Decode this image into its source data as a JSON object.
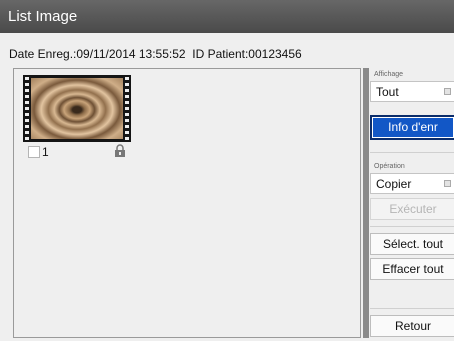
{
  "window": {
    "title": "List Image"
  },
  "patient_info": {
    "date_label": "Date Enreg.:09/11/2014 13:55:52",
    "id_label": "ID Patient:00123456"
  },
  "thumbnails": [
    {
      "number": "1",
      "locked": true,
      "checked": false
    }
  ],
  "sidebar": {
    "display_label": "Affichage",
    "display_value": "Tout",
    "info_button": "Info d'enr",
    "operation_label": "Opération",
    "operation_value": "Copier",
    "execute_button": "Exécuter",
    "select_all_button": "Sélect. tout",
    "clear_all_button": "Effacer tout",
    "back_button": "Retour"
  },
  "colors": {
    "titlebar": "#555555",
    "primary_button": "#1257c6"
  }
}
